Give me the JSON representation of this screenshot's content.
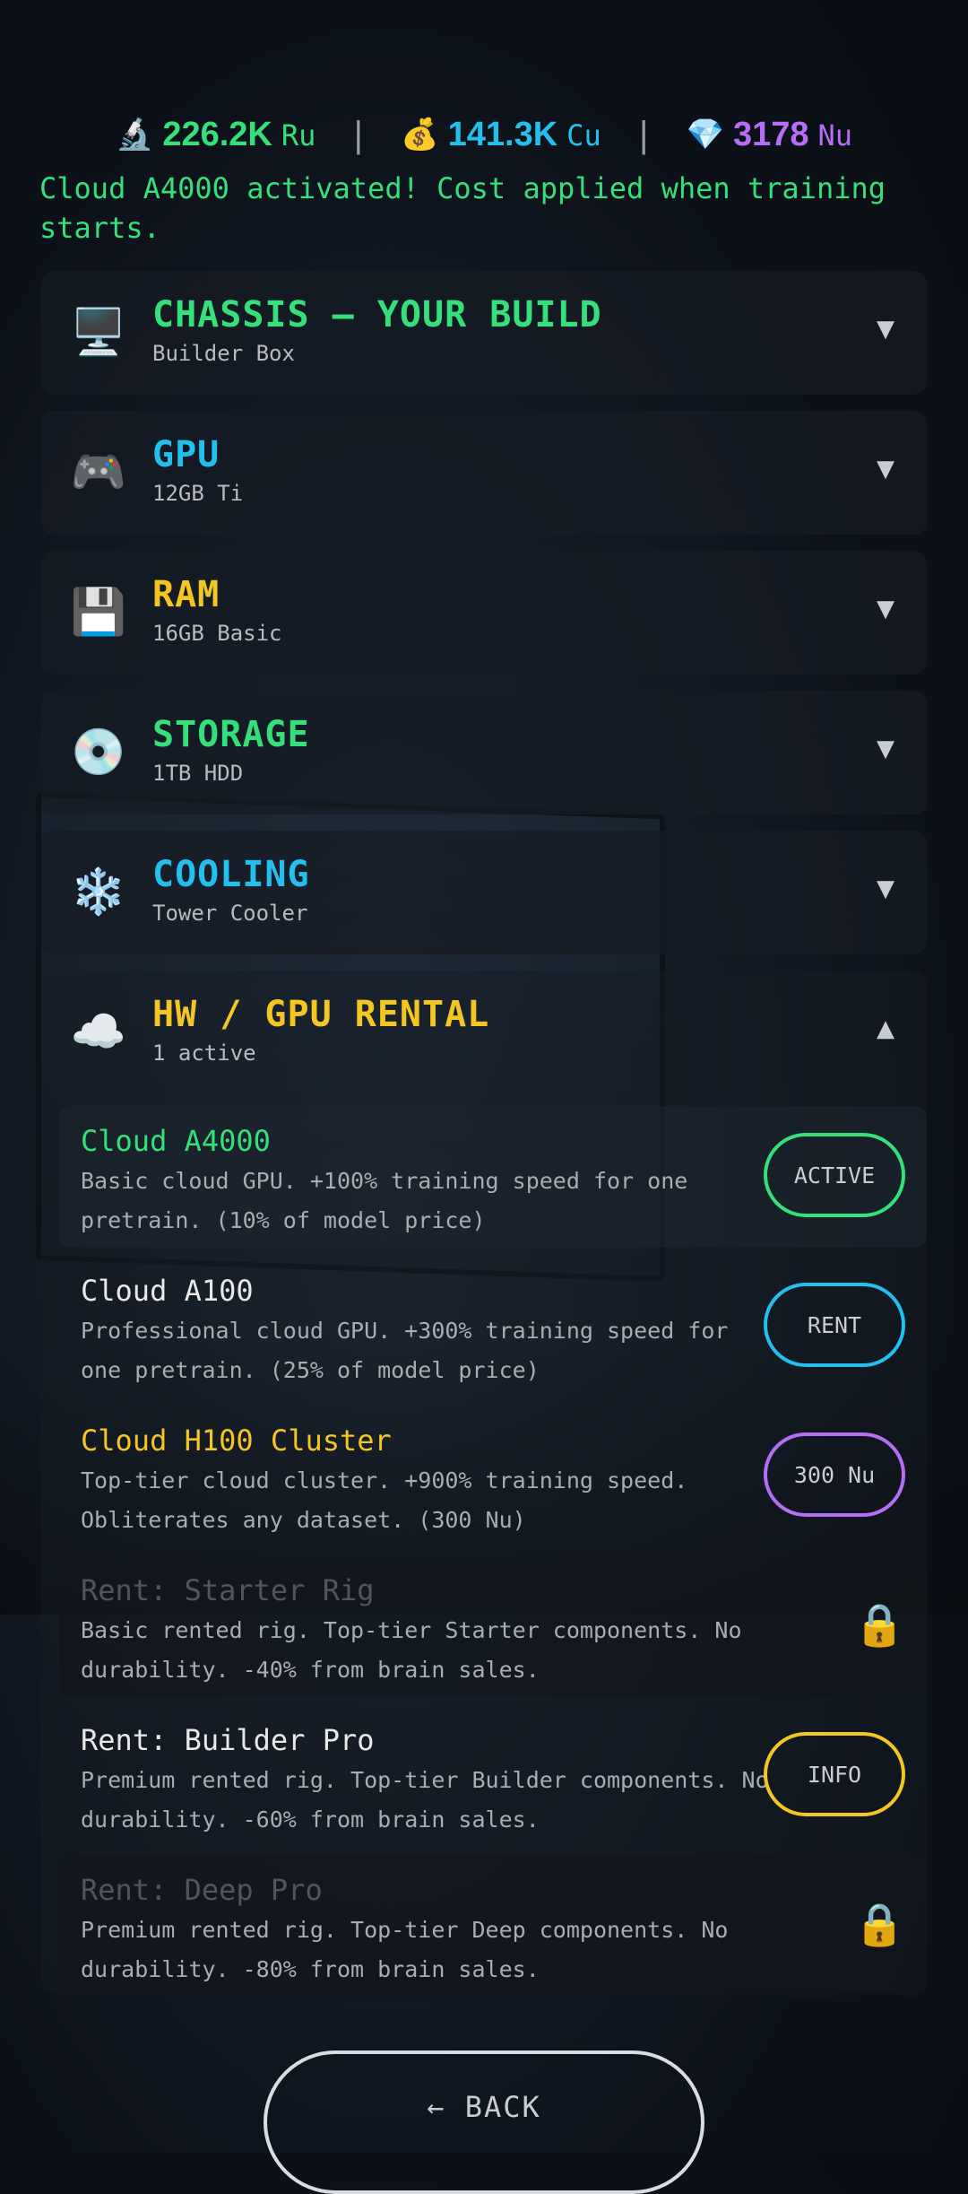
{
  "stats": {
    "research": {
      "icon": "🔬",
      "value": "226.2K",
      "unit": "Ru",
      "color": "#35e07a"
    },
    "cash": {
      "icon": "💰",
      "value": "141.3K",
      "unit": "Cu",
      "color": "#23c0ee"
    },
    "gems": {
      "icon": "💎",
      "value": "3178",
      "unit": "Nu",
      "color": "#b56ef5"
    },
    "separator": "|"
  },
  "notice": "Cloud A4000 activated! Cost applied when training starts.",
  "sections": [
    {
      "icon": "🖥️",
      "title": "CHASSIS — YOUR BUILD",
      "subtitle": "Builder Box",
      "color": "#35e07a",
      "chevron": "▼"
    },
    {
      "icon": "🎮",
      "title": "GPU",
      "subtitle": "12GB Ti",
      "color": "#23c0ee",
      "chevron": "▼"
    },
    {
      "icon": "💾",
      "title": "RAM",
      "subtitle": "16GB Basic",
      "color": "#f3c623",
      "chevron": "▼"
    },
    {
      "icon": "💿",
      "title": "STORAGE",
      "subtitle": "1TB HDD",
      "color": "#35e07a",
      "chevron": "▼"
    },
    {
      "icon": "❄️",
      "title": "COOLING",
      "subtitle": "Tower Cooler",
      "color": "#23c0ee",
      "chevron": "▼"
    },
    {
      "icon": "☁️",
      "title": "HW / GPU RENTAL",
      "subtitle": "1 active",
      "color": "#f3c623",
      "chevron": "▲"
    }
  ],
  "rentals": [
    {
      "title": "Cloud A4000",
      "desc": "Basic cloud GPU. +100% training speed for one pretrain. (10% of model price)",
      "button": "ACTIVE",
      "title_color": "#35e07a",
      "button_color": "#35e07a",
      "locked": false
    },
    {
      "title": "Cloud A100",
      "desc": "Professional cloud GPU. +300% training speed for one pretrain. (25% of model price)",
      "button": "RENT",
      "title_color": "#e8e8e8",
      "button_color": "#23c0ee",
      "locked": false
    },
    {
      "title": "Cloud H100 Cluster",
      "desc": "Top-tier cloud cluster. +900% training speed. Obliterates any dataset. (300 Nu)",
      "button": "300 Nu",
      "title_color": "#f3c623",
      "button_color": "#b56ef5",
      "locked": false
    },
    {
      "title": "Rent: Starter Rig",
      "desc": "Basic rented rig. Top-tier Starter components. No durability. -40% from brain sales.",
      "button": "",
      "icon": "🔒",
      "locked": true
    },
    {
      "title": "Rent: Builder Pro",
      "desc": "Premium rented rig. Top-tier Builder components. No durability. -60% from brain sales.",
      "button": "INFO",
      "title_color": "#e8e8e8",
      "button_color": "#f3c623",
      "locked": false
    },
    {
      "title": "Rent: Deep Pro",
      "desc": "Premium rented rig. Top-tier Deep components. No durability. -80% from brain sales.",
      "button": "",
      "icon": "🔒",
      "locked": true
    }
  ],
  "back_label": "← BACK"
}
